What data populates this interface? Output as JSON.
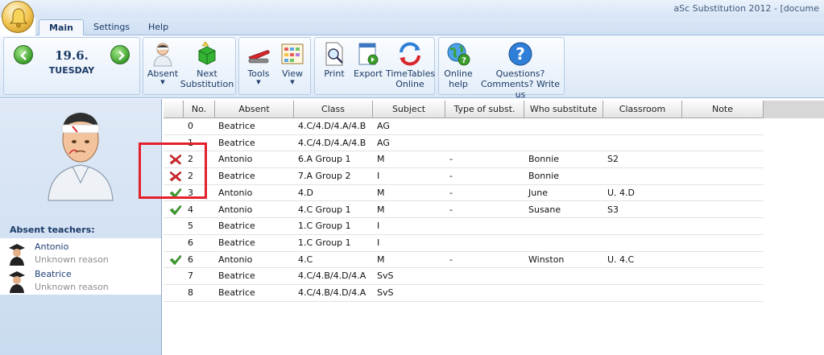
{
  "window": {
    "title": "aSc Substitution 2012 - [docume"
  },
  "tabs": [
    {
      "label": "Main",
      "active": true
    },
    {
      "label": "Settings",
      "active": false
    },
    {
      "label": "Help",
      "active": false
    }
  ],
  "ribbon": {
    "date": "19.6.",
    "weekday": "TUESDAY",
    "absent_label": "Absent",
    "next_substitution_label": [
      "Next",
      "Substitution"
    ],
    "tools_label": "Tools",
    "view_label": "View",
    "print_label": "Print",
    "export_label": "Export",
    "timetables_online_label": [
      "TimeTables",
      "Online"
    ],
    "online_help_label": [
      "Online",
      "help"
    ],
    "questions_label": [
      "Questions?",
      "Comments? Write us"
    ]
  },
  "left_panel": {
    "heading": "Absent teachers:",
    "teachers": [
      {
        "name": "Antonio",
        "reason": "Unknown reason"
      },
      {
        "name": "Beatrice",
        "reason": "Unknown reason"
      }
    ]
  },
  "table": {
    "columns": [
      "No.",
      "Absent",
      "Class",
      "Subject",
      "Type of subst.",
      "Who substitute",
      "Classroom",
      "Note"
    ],
    "rows": [
      {
        "status": "",
        "no": "0",
        "absent": "Beatrice",
        "class": "4.C/4.D/4.A/4.B",
        "subject": "AG",
        "type": "",
        "who": "",
        "classroom": "",
        "note": ""
      },
      {
        "status": "",
        "no": "1",
        "absent": "Beatrice",
        "class": "4.C/4.D/4.A/4.B",
        "subject": "AG",
        "type": "",
        "who": "",
        "classroom": "",
        "note": ""
      },
      {
        "status": "cross",
        "no": "2",
        "absent": "Antonio",
        "class": "6.A Group 1",
        "subject": "M",
        "type": "-",
        "who": "Bonnie",
        "classroom": "S2",
        "note": ""
      },
      {
        "status": "cross",
        "no": "2",
        "absent": "Beatrice",
        "class": "7.A Group 2",
        "subject": "I",
        "type": "-",
        "who": "Bonnie",
        "classroom": "",
        "note": ""
      },
      {
        "status": "check",
        "no": "3",
        "absent": "Antonio",
        "class": "4.D",
        "subject": "M",
        "type": "-",
        "who": "June",
        "classroom": "U. 4.D",
        "note": ""
      },
      {
        "status": "check",
        "no": "4",
        "absent": "Antonio",
        "class": "4.C Group 1",
        "subject": "M",
        "type": "-",
        "who": "Susane",
        "classroom": "S3",
        "note": ""
      },
      {
        "status": "",
        "no": "5",
        "absent": "Beatrice",
        "class": "1.C Group 1",
        "subject": "I",
        "type": "",
        "who": "",
        "classroom": "",
        "note": ""
      },
      {
        "status": "",
        "no": "6",
        "absent": "Beatrice",
        "class": "1.C Group 1",
        "subject": "I",
        "type": "",
        "who": "",
        "classroom": "",
        "note": ""
      },
      {
        "status": "check",
        "no": "6",
        "absent": "Antonio",
        "class": "4.C",
        "subject": "M",
        "type": "-",
        "who": "Winston",
        "classroom": "U. 4.C",
        "note": ""
      },
      {
        "status": "",
        "no": "7",
        "absent": "Beatrice",
        "class": "4.C/4.B/4.D/4.A",
        "subject": "SvS",
        "type": "",
        "who": "",
        "classroom": "",
        "note": ""
      },
      {
        "status": "",
        "no": "8",
        "absent": "Beatrice",
        "class": "4.C/4.B/4.D/4.A",
        "subject": "SvS",
        "type": "",
        "who": "",
        "classroom": "",
        "note": ""
      }
    ]
  },
  "colors": {
    "highlight": "#e3202b",
    "check": "#3b9e2a",
    "cross": "#d9262c"
  }
}
